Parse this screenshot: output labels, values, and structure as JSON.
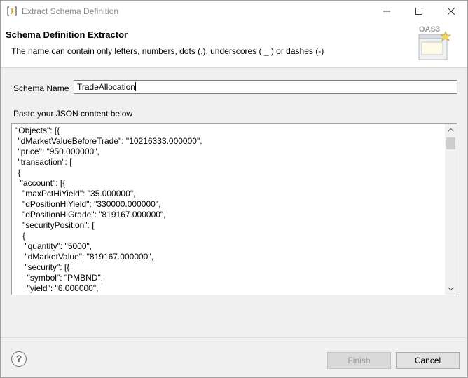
{
  "window": {
    "title": "Extract Schema Definition"
  },
  "header": {
    "title": "Schema Definition Extractor",
    "description": "The name can contain only letters, numbers, dots (.), underscores ( _ ) or dashes (-)",
    "banner_text": "OAS3"
  },
  "form": {
    "schema_name_label": "Schema Name",
    "schema_name_value": "TradeAllocation",
    "json_label": "Paste your JSON content below",
    "json_lines": [
      "\"Objects\": [{",
      " \"dMarketValueBeforeTrade\": \"10216333.000000\",",
      " \"price\": \"950.000000\",",
      " \"transaction\": [",
      " {",
      "  \"account\": [{",
      "   \"maxPctHiYield\": \"35.000000\",",
      "   \"dPositionHiYield\": \"330000.000000\",",
      "   \"dPositionHiGrade\": \"819167.000000\",",
      "   \"securityPosition\": [",
      "   {",
      "    \"quantity\": \"5000\",",
      "    \"dMarketValue\": \"819167.000000\",",
      "    \"security\": [{",
      "     \"symbol\": \"PMBND\",",
      "     \"yield\": \"6.000000\","
    ]
  },
  "footer": {
    "help_symbol": "?",
    "finish_label": "Finish",
    "cancel_label": "Cancel"
  },
  "icons": {
    "app": "app-icon",
    "minimize": "minimize-icon",
    "maximize": "maximize-icon",
    "close": "close-icon",
    "help": "help-icon",
    "scroll_up": "chevron-up-icon",
    "scroll_down": "chevron-down-icon"
  },
  "colors": {
    "title_text": "#8a8a8a",
    "disabled_text": "#9a9a9a",
    "banner_accent": "#f5d76e"
  }
}
